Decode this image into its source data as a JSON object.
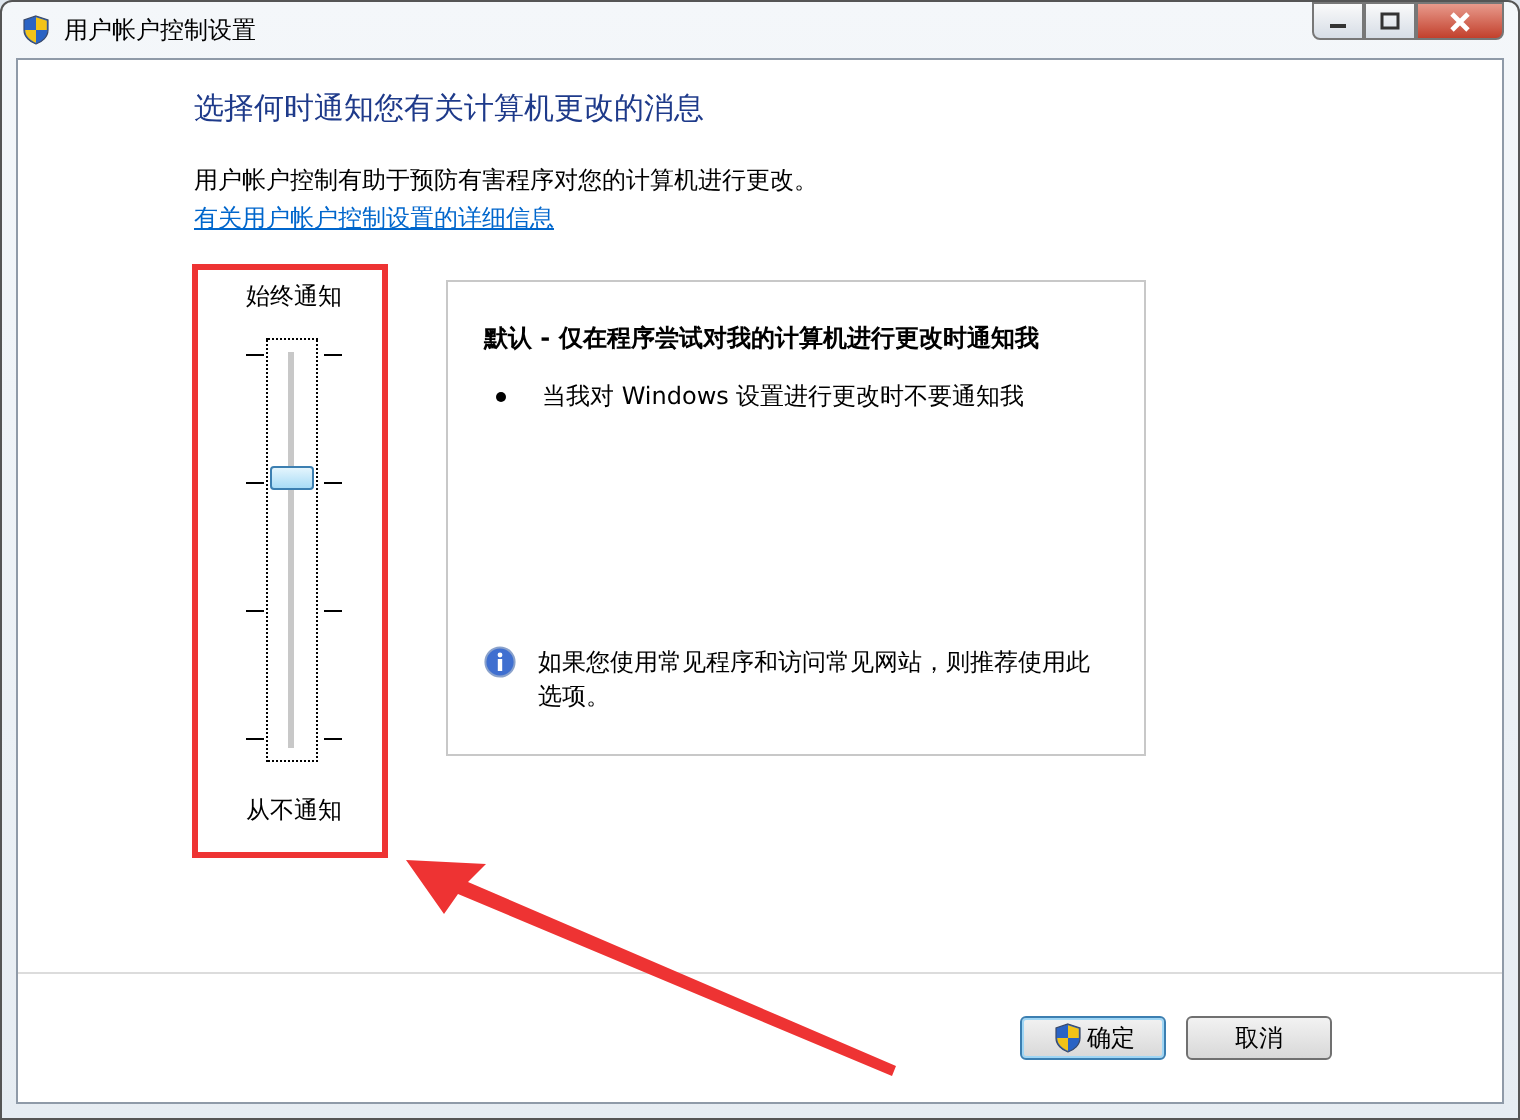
{
  "window": {
    "title": "用户帐户控制设置"
  },
  "heading": "选择何时通知您有关计算机更改的消息",
  "description": "用户帐户控制有助于预防有害程序对您的计算机进行更改。",
  "link": "有关用户帐户控制设置的详细信息",
  "slider": {
    "top_label": "始终通知",
    "bottom_label": "从不通知",
    "level": 0.67
  },
  "info_panel": {
    "title": "默认 - 仅在程序尝试对我的计算机进行更改时通知我",
    "bullets": [
      "当我对 Windows 设置进行更改时不要通知我"
    ],
    "note": "如果您使用常见程序和访问常见网站，则推荐使用此选项。"
  },
  "buttons": [
    {
      "label": "确定",
      "kind": "shield",
      "default": true
    },
    {
      "label": "取消",
      "kind": "plain",
      "default": false
    }
  ],
  "highlight_box": {
    "color": "#ee3333"
  },
  "arrow": {
    "color": "#ee3333"
  }
}
